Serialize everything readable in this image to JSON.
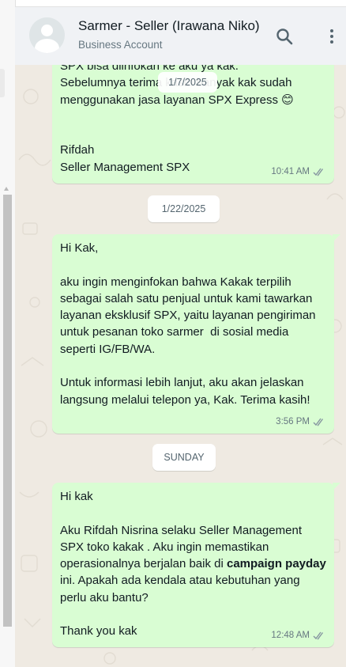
{
  "header": {
    "name": "Sarmer - Seller (Irawana Niko)",
    "subtitle": "Business Account",
    "search_icon": "search-icon",
    "menu_icon": "kebab-menu-icon"
  },
  "sticky_date": "1/7/2025",
  "messages": [
    {
      "text_lines": [
        "SPX bisa diinfokan ke aku ya kak.",
        "Sebelumnya terima kasih banyak kak sudah",
        "menggunakan jasa layanan SPX Express 😊",
        "",
        "",
        "Rifdah",
        "Seller Management SPX"
      ],
      "time": "10:41 AM"
    },
    {
      "text": "Hi Kak,\n\naku ingin menginfokan bahwa Kakak terpilih sebagai salah satu penjual untuk kami tawarkan layanan eksklusif SPX, yaitu layanan pengiriman untuk pesanan toko sarmer  di sosial media seperti IG/FB/WA.\n\nUntuk informasi lebih lanjut, aku akan jelaskan langsung melalui telepon ya, Kak. Terima kasih!",
      "time": "3:56 PM"
    },
    {
      "text_before": "Hi kak\n\nAku Rifdah Nisrina selaku Seller Management SPX toko kakak . Aku ingin memastikan operasionalnya berjalan baik di ",
      "bold": "campaign payday",
      "text_after": " ini. Apakah ada kendala atau kebutuhan yang perlu aku bantu?\n\nThank you kak",
      "time": "12:48 AM"
    }
  ],
  "date_dividers": [
    "1/22/2025",
    "SUNDAY"
  ],
  "colors": {
    "outgoing_bubble": "#d9fdd3",
    "chat_background": "#efeae2",
    "header_background": "#f0f2f5",
    "read_receipt": "#8696a0"
  }
}
